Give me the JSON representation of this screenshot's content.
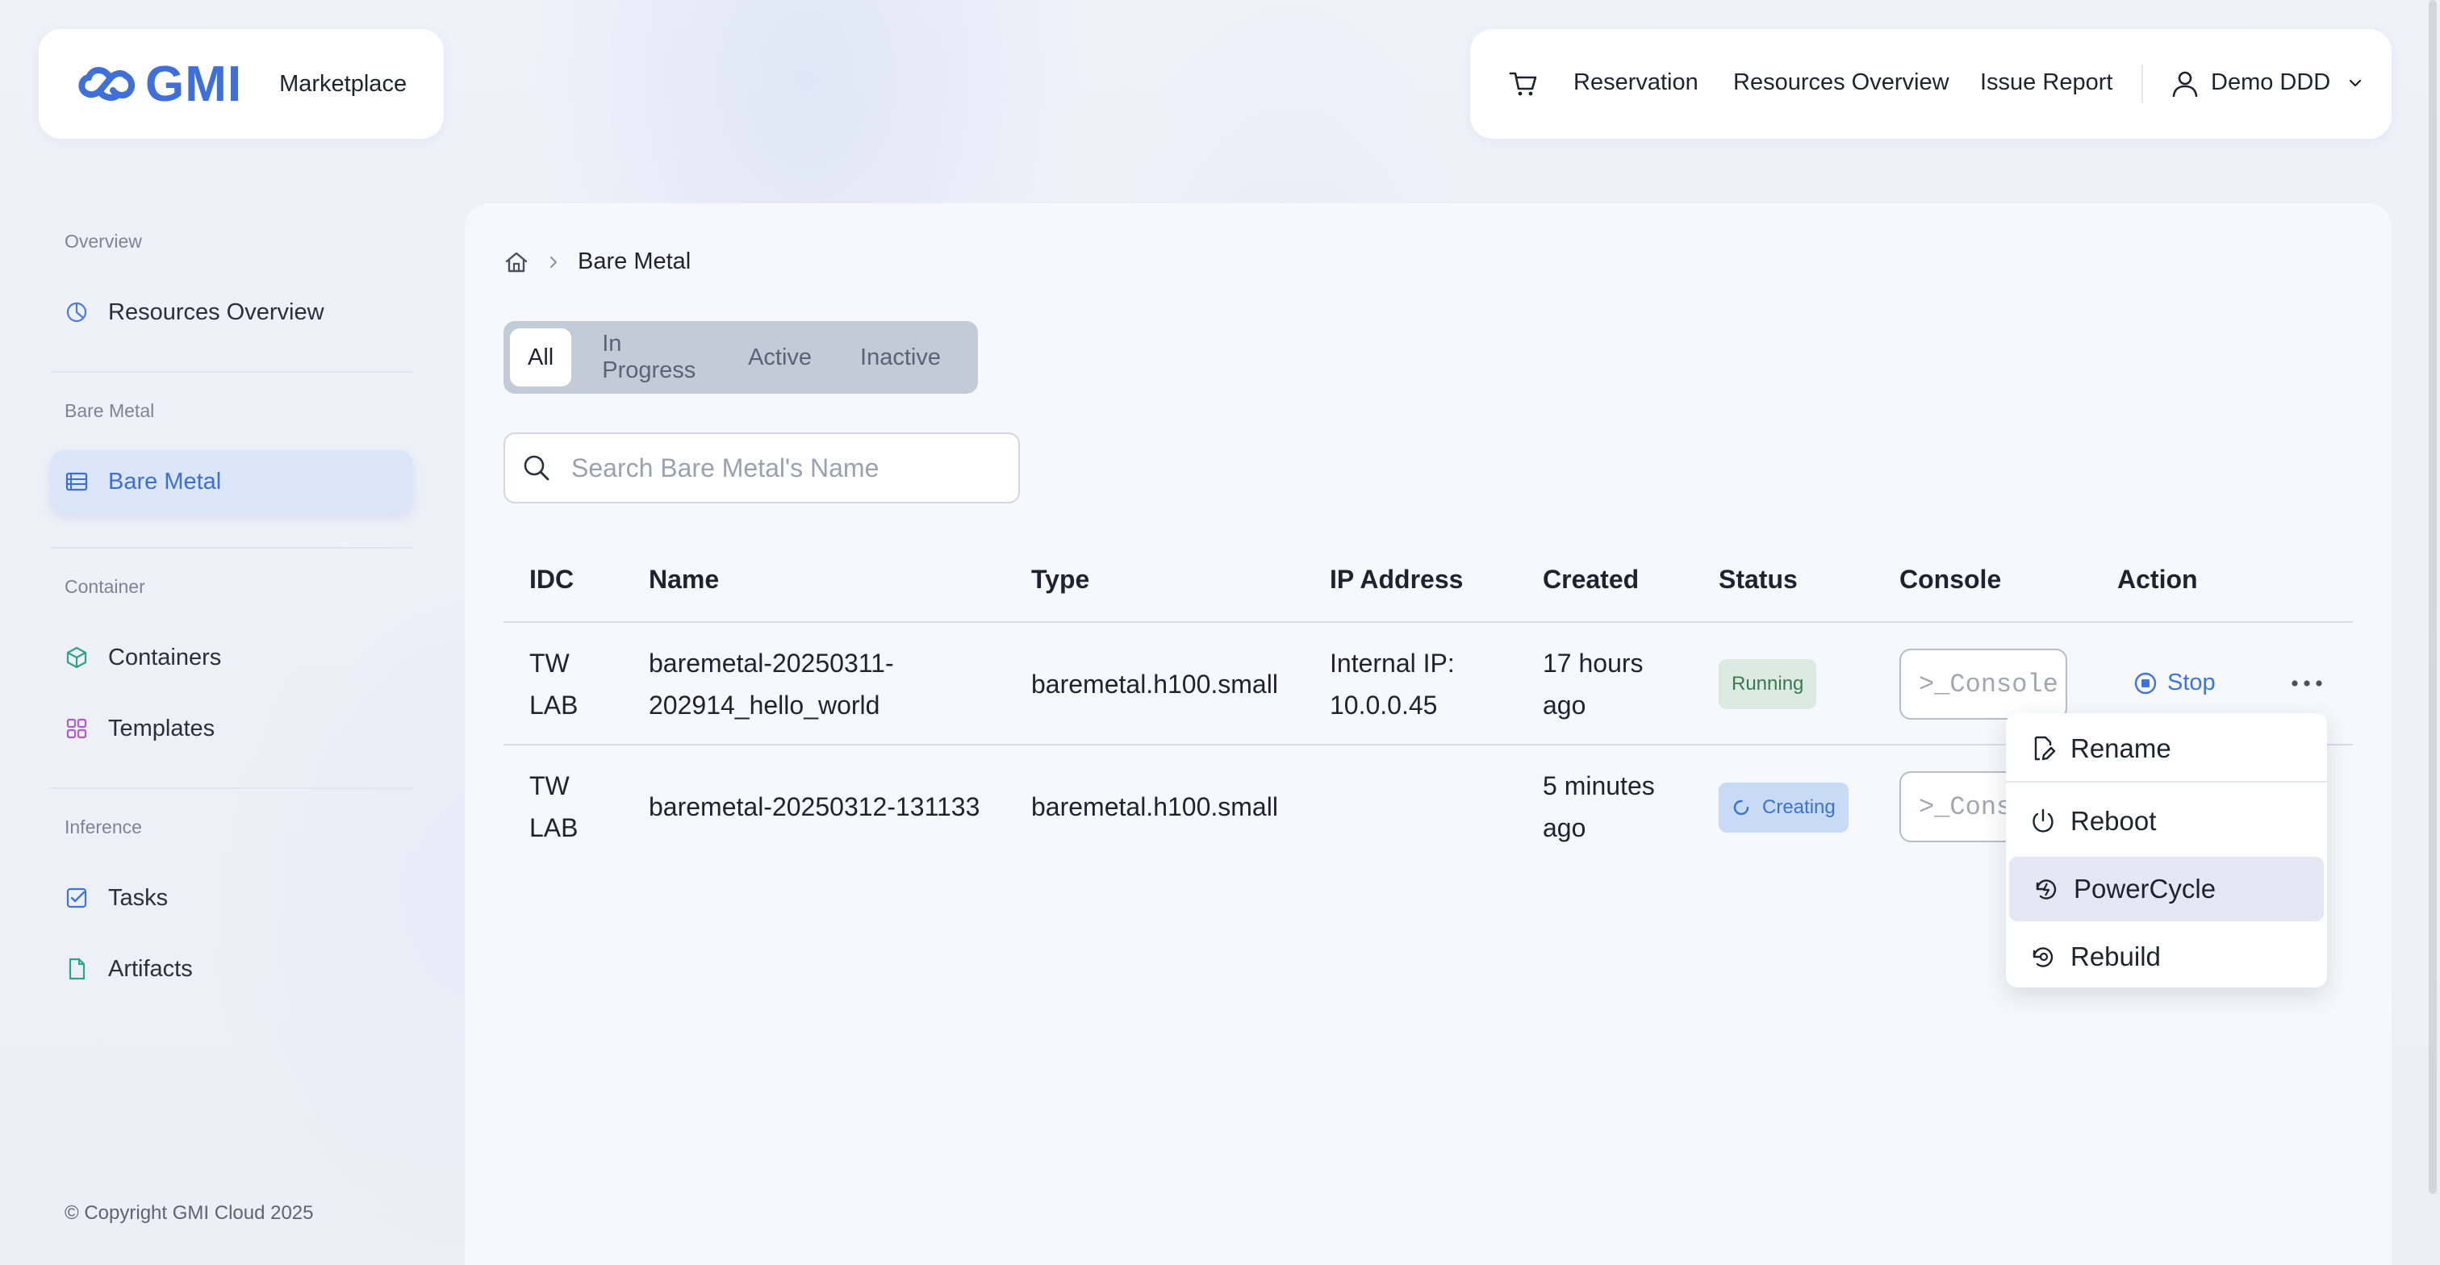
{
  "header": {
    "logo_text": "GMI",
    "marketplace_label": "Marketplace",
    "nav": [
      "Reservation",
      "Resources Overview",
      "Issue Report"
    ],
    "user_name": "Demo DDD"
  },
  "sidebar": {
    "sections": [
      {
        "title": "Overview",
        "items": [
          {
            "label": "Resources Overview",
            "icon": "pie-chart-icon"
          }
        ]
      },
      {
        "title": "Bare Metal",
        "items": [
          {
            "label": "Bare Metal",
            "icon": "server-icon",
            "active": true
          }
        ]
      },
      {
        "title": "Container",
        "items": [
          {
            "label": "Containers",
            "icon": "cube-icon"
          },
          {
            "label": "Templates",
            "icon": "grid-icon"
          }
        ]
      },
      {
        "title": "Inference",
        "items": [
          {
            "label": "Tasks",
            "icon": "checkbox-icon"
          },
          {
            "label": "Artifacts",
            "icon": "file-icon"
          }
        ]
      }
    ],
    "copyright": "© Copyright GMI Cloud 2025"
  },
  "breadcrumb": {
    "current": "Bare Metal"
  },
  "tabs": [
    "All",
    "In Progress",
    "Active",
    "Inactive"
  ],
  "active_tab": "All",
  "search": {
    "placeholder": "Search Bare Metal's Name",
    "value": ""
  },
  "table": {
    "columns": [
      "IDC",
      "Name",
      "Type",
      "IP Address",
      "Created",
      "Status",
      "Console",
      "Action"
    ],
    "rows": [
      {
        "idc_1": "TW",
        "idc_2": "LAB",
        "name_1": "baremetal-20250311-",
        "name_2": "202914_hello_world",
        "type": "baremetal.h100.small",
        "ip_1": "Internal IP:",
        "ip_2": "10.0.0.45",
        "created_1": "17 hours",
        "created_2": "ago",
        "status": "Running",
        "console": ">_Console",
        "action": "Stop"
      },
      {
        "idc_1": "TW",
        "idc_2": "LAB",
        "name": "baremetal-20250312-131133",
        "type": "baremetal.h100.small",
        "created_1": "5 minutes",
        "created_2": "ago",
        "status": "Creating",
        "console": ">_Console"
      }
    ]
  },
  "action_menu": [
    "Rename",
    "Reboot",
    "PowerCycle",
    "Rebuild"
  ],
  "colors": {
    "accent": "#3f6fd8",
    "running_bg": "#dcebe1",
    "creating_bg": "#c7dbf7",
    "tab_bar": "#c3cad8"
  }
}
